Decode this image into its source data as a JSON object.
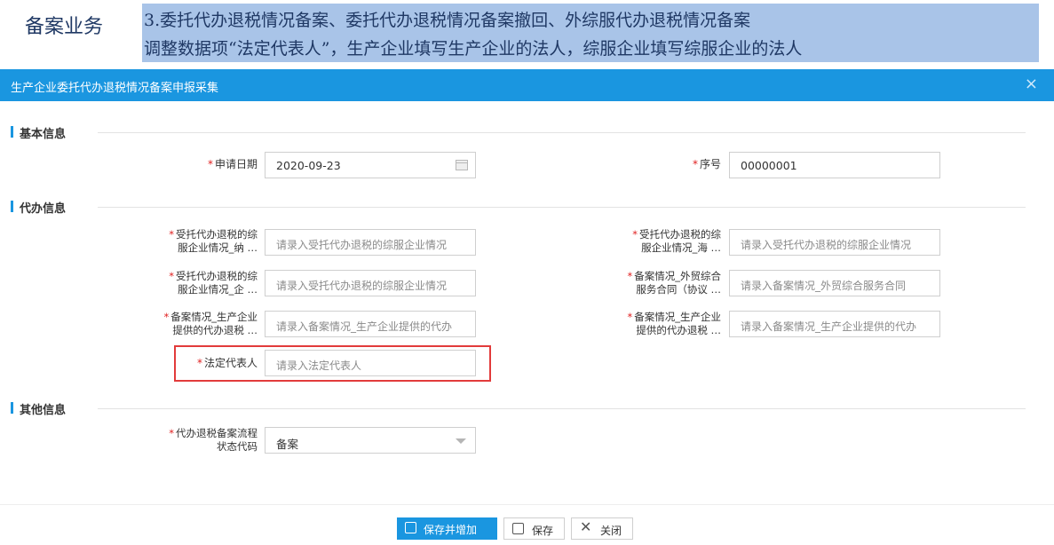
{
  "banner": {
    "tag": "备案业务",
    "line1": "3.委托代办退税情况备案、委托代办退税情况备案撤回、外综服代办退税情况备案",
    "line2": "调整数据项“法定代表人”，生产企业填写生产企业的法人，综服企业填写综服企业的法人"
  },
  "dialog": {
    "title": "生产企业委托代办退税情况备案申报采集",
    "close_glyph": "×"
  },
  "sections": {
    "basic": "基本信息",
    "agent": "代办信息",
    "other": "其他信息"
  },
  "basic": {
    "apply_date_label": "申请日期",
    "apply_date_value": "2020-09-23",
    "seq_label": "序号",
    "seq_value": "00000001"
  },
  "agent": {
    "f1_label_a": "受托代办退税的综",
    "f1_label_b": "服企业情况_纳 …",
    "f1_placeholder": "请录入受托代办退税的综服企业情况",
    "f2_label_a": "受托代办退税的综",
    "f2_label_b": "服企业情况_海 …",
    "f2_placeholder": "请录入受托代办退税的综服企业情况",
    "f3_label_a": "受托代办退税的综",
    "f3_label_b": "服企业情况_企 …",
    "f3_placeholder": "请录入受托代办退税的综服企业情况",
    "f4_label_a": "备案情况_外贸综合",
    "f4_label_b": "服务合同（协议 …",
    "f4_placeholder": "请录入备案情况_外贸综合服务合同",
    "f5_label_a": "备案情况_生产企业",
    "f5_label_b": "提供的代办退税 …",
    "f5_placeholder": "请录入备案情况_生产企业提供的代办",
    "f6_label_a": "备案情况_生产企业",
    "f6_label_b": "提供的代办退税 …",
    "f6_placeholder": "请录入备案情况_生产企业提供的代办",
    "legal_label": "法定代表人",
    "legal_placeholder": "请录入法定代表人"
  },
  "other": {
    "status_label_a": "代办退税备案流程",
    "status_label_b": "状态代码",
    "status_value": "备案"
  },
  "buttons": {
    "save_add": "保存并增加",
    "save": "保存",
    "close": "关闭"
  },
  "colors": {
    "accent": "#1a96e0",
    "highlight": "#e23b3b",
    "banner_bg": "#a9c4e8",
    "required": "#e02020"
  }
}
